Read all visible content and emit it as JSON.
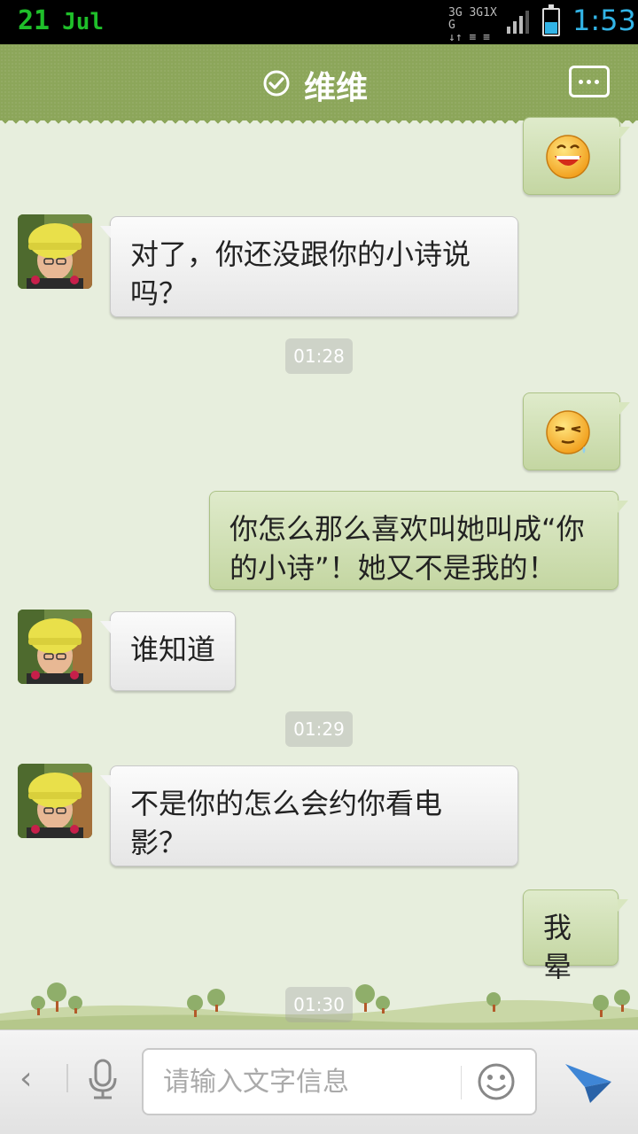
{
  "status_bar": {
    "day": "21",
    "month": "Jul",
    "network": [
      "3G",
      "3G",
      "1X",
      "G"
    ],
    "time": "1:53",
    "battery_level": 0.45
  },
  "header": {
    "title": "维维",
    "more_icon": "more-icon",
    "verified_icon": "check-circle-icon"
  },
  "messages": [
    {
      "side": "out",
      "type": "emoji",
      "emoji": "laughing-face"
    },
    {
      "side": "in",
      "text": "对了，你还没跟你的小诗说吗？"
    },
    {
      "type": "time",
      "text": "01:28"
    },
    {
      "side": "out",
      "type": "emoji",
      "emoji": "sweat-face"
    },
    {
      "side": "out",
      "text": "你怎么那么喜欢叫她叫成“你的小诗”！她又不是我的！"
    },
    {
      "side": "in",
      "text": "谁知道"
    },
    {
      "type": "time",
      "text": "01:29"
    },
    {
      "side": "in",
      "text": "不是你的怎么会约你看电影？"
    },
    {
      "side": "out",
      "text": "我晕"
    },
    {
      "type": "time",
      "text": "01:30"
    }
  ],
  "input_bar": {
    "placeholder": "请输入文字信息",
    "back_label": "‹"
  },
  "colors": {
    "header": "#8ca65a",
    "outgoing_bubble": "#cfdfb3",
    "incoming_bubble": "#f0f0f0",
    "clock": "#32b4e6"
  }
}
